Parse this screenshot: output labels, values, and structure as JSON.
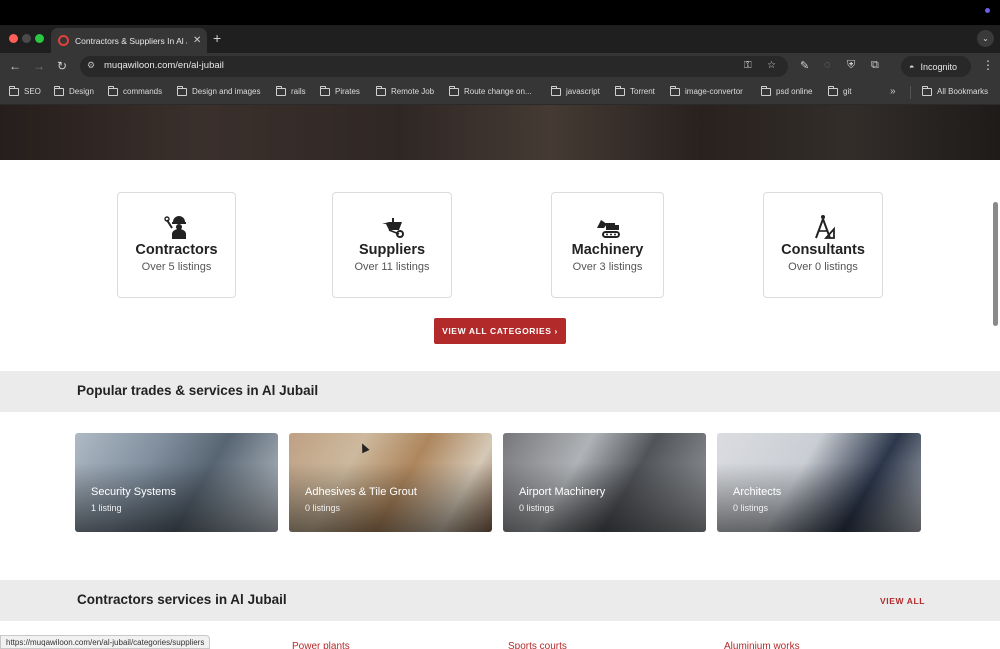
{
  "browser": {
    "tab_title": "Contractors & Suppliers In Al Jubail",
    "url": "muqawiloon.com/en/al-jubail",
    "incognito_label": "Incognito",
    "bookmarks": [
      "SEO",
      "Design",
      "commands",
      "Design and images",
      "rails",
      "Pirates",
      "Remote Job",
      "Route change on...",
      "javascript",
      "Torrent",
      "image-convertor",
      "psd online",
      "git"
    ],
    "all_bookmarks": "All Bookmarks",
    "status_url": "https://muqawiloon.com/en/al-jubail/categories/suppliers"
  },
  "categories": [
    {
      "name": "Contractors",
      "count": "Over 5 listings",
      "icon": "worker-icon"
    },
    {
      "name": "Suppliers",
      "count": "Over 11 listings",
      "icon": "wheelbarrow-icon"
    },
    {
      "name": "Machinery",
      "count": "Over 3 listings",
      "icon": "excavator-icon"
    },
    {
      "name": "Consultants",
      "count": "Over 0 listings",
      "icon": "drafting-compass-icon"
    }
  ],
  "view_all_categories": "VIEW ALL CATEGORIES ›",
  "popular": {
    "title": "Popular trades & services in Al Jubail",
    "items": [
      {
        "name": "Security Systems",
        "count": "1 listing"
      },
      {
        "name": "Adhesives & Tile Grout",
        "count": "0 listings"
      },
      {
        "name": "Airport Machinery",
        "count": "0 listings"
      },
      {
        "name": "Architects",
        "count": "0 listings"
      }
    ]
  },
  "contractors": {
    "title": "Contractors services in Al Jubail",
    "view_all": "VIEW ALL",
    "links": [
      "Power plants",
      "Sports courts",
      "Aluminium works"
    ]
  },
  "colors": {
    "accent": "#b22a2a",
    "band": "#ebebeb"
  }
}
